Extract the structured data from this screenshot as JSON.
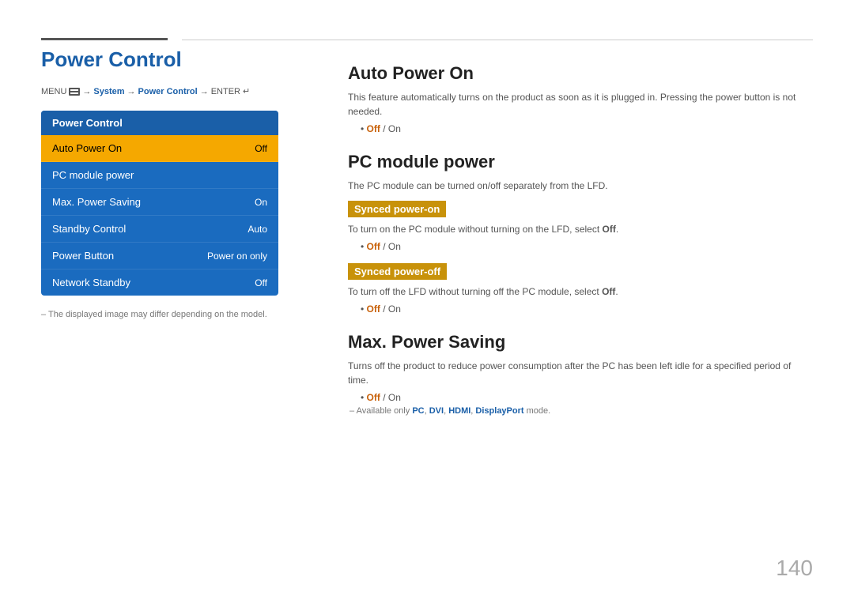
{
  "page": {
    "number": "140"
  },
  "top_border": {},
  "left": {
    "title": "Power Control",
    "menu_path": {
      "menu_label": "MENU",
      "arrow1": "→",
      "system": "System",
      "arrow2": "→",
      "power_control": "Power Control",
      "arrow3": "→",
      "enter": "ENTER"
    },
    "menu_box": {
      "header": "Power Control",
      "items": [
        {
          "label": "Auto Power On",
          "value": "Off",
          "active": true
        },
        {
          "label": "PC module power",
          "value": "",
          "active": false
        },
        {
          "label": "Max. Power Saving",
          "value": "On",
          "active": false
        },
        {
          "label": "Standby Control",
          "value": "Auto",
          "active": false
        },
        {
          "label": "Power Button",
          "value": "Power on only",
          "active": false
        },
        {
          "label": "Network Standby",
          "value": "Off",
          "active": false
        }
      ]
    },
    "footnote": "The displayed image may differ depending on the model."
  },
  "right": {
    "sections": [
      {
        "id": "auto-power-on",
        "title": "Auto Power On",
        "desc": "This feature automatically turns on the product as soon as it is plugged in. Pressing the power button is not needed.",
        "bullet": "Off / On",
        "subsections": []
      },
      {
        "id": "pc-module-power",
        "title": "PC module power",
        "desc": "The PC module can be turned on/off separately from the LFD.",
        "bullet": "",
        "subsections": [
          {
            "title": "Synced power-on",
            "desc": "To turn on the PC module without turning on the LFD, select Off.",
            "bullet": "Off / On"
          },
          {
            "title": "Synced power-off",
            "desc": "To turn off the LFD without turning off the PC module, select Off.",
            "bullet": "Off / On"
          }
        ]
      },
      {
        "id": "max-power-saving",
        "title": "Max. Power Saving",
        "desc": "Turns off the product to reduce power consumption after the PC has been left idle for a specified period of time.",
        "bullet": "Off / On",
        "note": "Available only PC, DVI, HDMI, DisplayPort mode.",
        "note_highlights": [
          "PC",
          "DVI",
          "HDMI",
          "DisplayPort"
        ],
        "subsections": []
      }
    ]
  }
}
